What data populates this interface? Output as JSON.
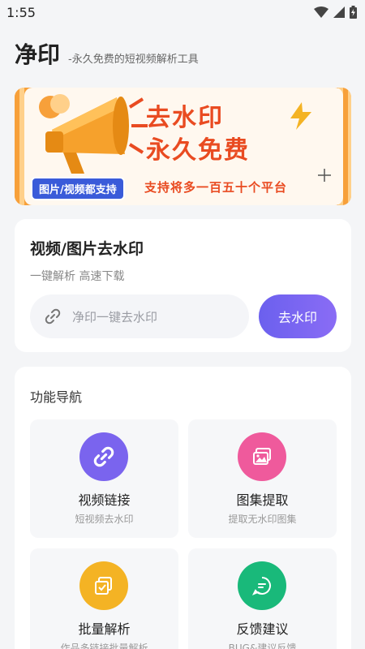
{
  "status_bar": {
    "time": "1:55"
  },
  "header": {
    "title": "净印",
    "subtitle": "-永久免费的短视频解析工具"
  },
  "banner": {
    "headline_line1": "去水印",
    "headline_line2": "永久免费",
    "tag": "图片/视频都支持",
    "support_text": "支持将多一百五十个平台",
    "colors": {
      "frame": "#f7a03a",
      "text": "#e94b21",
      "tag_bg": "#3a5bd9"
    }
  },
  "parse_card": {
    "title": "视频/图片去水印",
    "subtitle": "一键解析 高速下载",
    "input_placeholder": "净印一键去水印",
    "button_label": "去水印",
    "icon": "link-icon"
  },
  "nav_card": {
    "title": "功能导航",
    "tiles": [
      {
        "label": "视频链接",
        "sub": "短视频去水印",
        "icon": "link-icon",
        "color": "#7a64ee"
      },
      {
        "label": "图集提取",
        "sub": "提取无水印图集",
        "icon": "gallery-icon",
        "color": "#ef5a9c"
      },
      {
        "label": "批量解析",
        "sub": "作品多链接批量解析",
        "icon": "batch-icon",
        "color": "#f4b324"
      },
      {
        "label": "反馈建议",
        "sub": "BUG&建议反馈",
        "icon": "chat-icon",
        "color": "#19b97a"
      }
    ]
  }
}
